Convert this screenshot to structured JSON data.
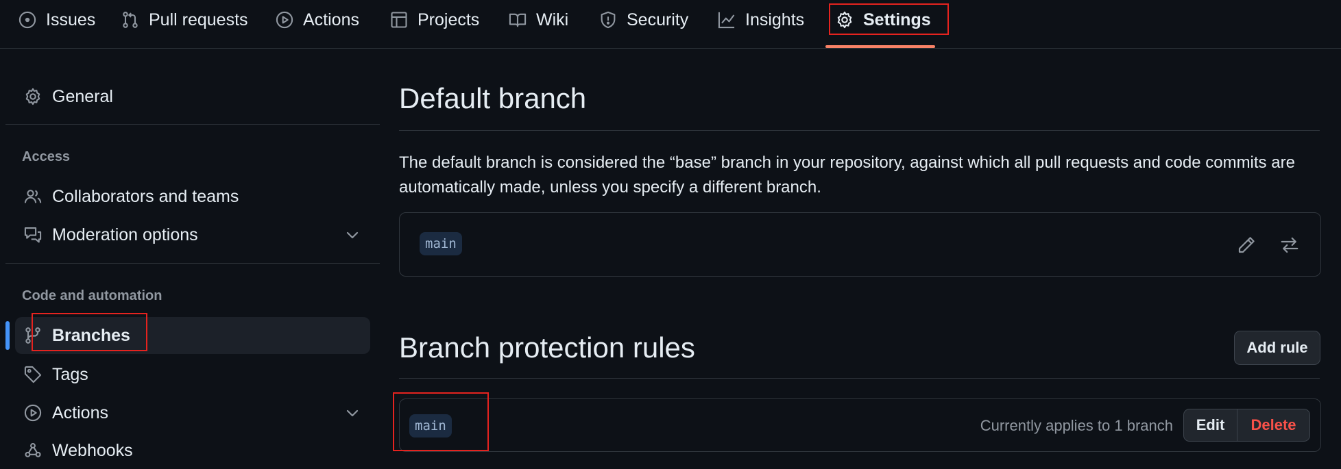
{
  "nav": {
    "tabs": [
      {
        "label": "Issues",
        "icon": "issue-circle-icon"
      },
      {
        "label": "Pull requests",
        "icon": "pull-request-icon"
      },
      {
        "label": "Actions",
        "icon": "play-circle-icon"
      },
      {
        "label": "Projects",
        "icon": "table-icon"
      },
      {
        "label": "Wiki",
        "icon": "book-icon"
      },
      {
        "label": "Security",
        "icon": "shield-icon"
      },
      {
        "label": "Insights",
        "icon": "graph-icon"
      },
      {
        "label": "Settings",
        "icon": "gear-icon",
        "active": true
      }
    ]
  },
  "sidebar": {
    "general": "General",
    "access_heading": "Access",
    "collaborators": "Collaborators and teams",
    "moderation": "Moderation options",
    "code_heading": "Code and automation",
    "branches": "Branches",
    "tags": "Tags",
    "actions": "Actions",
    "webhooks": "Webhooks"
  },
  "default_branch": {
    "title": "Default branch",
    "description": "The default branch is considered the “base” branch in your repository, against which all pull requests and code commits are automatically made, unless you specify a different branch.",
    "branch": "main"
  },
  "protection": {
    "title": "Branch protection rules",
    "add_rule_label": "Add rule",
    "rule_branch": "main",
    "applies_text": "Currently applies to 1 branch",
    "edit_label": "Edit",
    "delete_label": "Delete"
  },
  "colors": {
    "background": "#0d1117",
    "accent_underline": "#f78166",
    "active_indicator": "#4493f8",
    "danger": "#f85149",
    "highlight_box": "#e5231f"
  }
}
